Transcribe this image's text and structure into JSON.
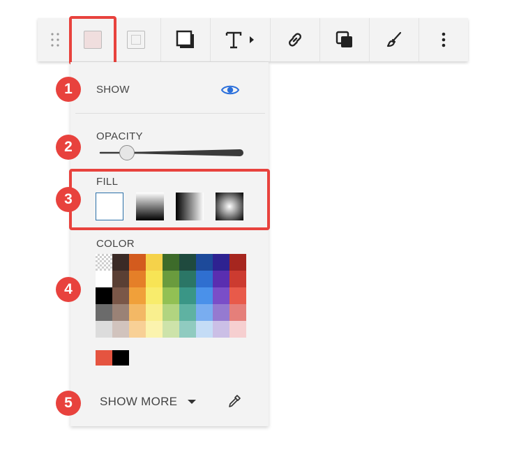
{
  "toolbar": {
    "items": [
      "drag-handle",
      "fill-color",
      "stroke-color",
      "shadow",
      "text",
      "link",
      "arrange",
      "style",
      "more"
    ]
  },
  "panel": {
    "show": {
      "label": "SHOW"
    },
    "opacity": {
      "label": "OPACITY",
      "value": 0.15
    },
    "fill": {
      "label": "FILL",
      "options": [
        "solid",
        "linear-vertical",
        "linear-horizontal",
        "radial"
      ],
      "selected": "solid"
    },
    "color": {
      "label": "COLOR",
      "swatches": [
        [
          "transparent",
          "#3a2a26",
          "#d35b1e",
          "#f5d24a",
          "#3d6b2a",
          "#1f4a3e",
          "#1d4a9a",
          "#2e2291",
          "#a6261f"
        ],
        [
          "#ffffff",
          "#5a3f34",
          "#e57f28",
          "#f7e455",
          "#6a9b3e",
          "#2b7666",
          "#2f6fd0",
          "#5a2eb0",
          "#cc3b30"
        ],
        [
          "#000000",
          "#7a5748",
          "#f0a03a",
          "#f8ec6c",
          "#92c054",
          "#3a9686",
          "#4a91ea",
          "#7a4ec8",
          "#e85a4a"
        ],
        [
          "#6b6b6b",
          "#9a8276",
          "#f3b865",
          "#f9ef8e",
          "#b1d480",
          "#5fb2a2",
          "#79adf0",
          "#957ad0",
          "#e57f7a"
        ],
        [
          "#dcdcdc",
          "#d1c3bd",
          "#f8d096",
          "#fbf3ae",
          "#cde3aa",
          "#90cbc0",
          "#c4dcf6",
          "#cbbfe6",
          "#f6cfd0"
        ]
      ],
      "recent": [
        "#e55440",
        "#000000"
      ]
    },
    "show_more": {
      "label": "SHOW MORE"
    }
  },
  "callouts": [
    "1",
    "2",
    "3",
    "4",
    "5"
  ],
  "accent": "#e8423d"
}
